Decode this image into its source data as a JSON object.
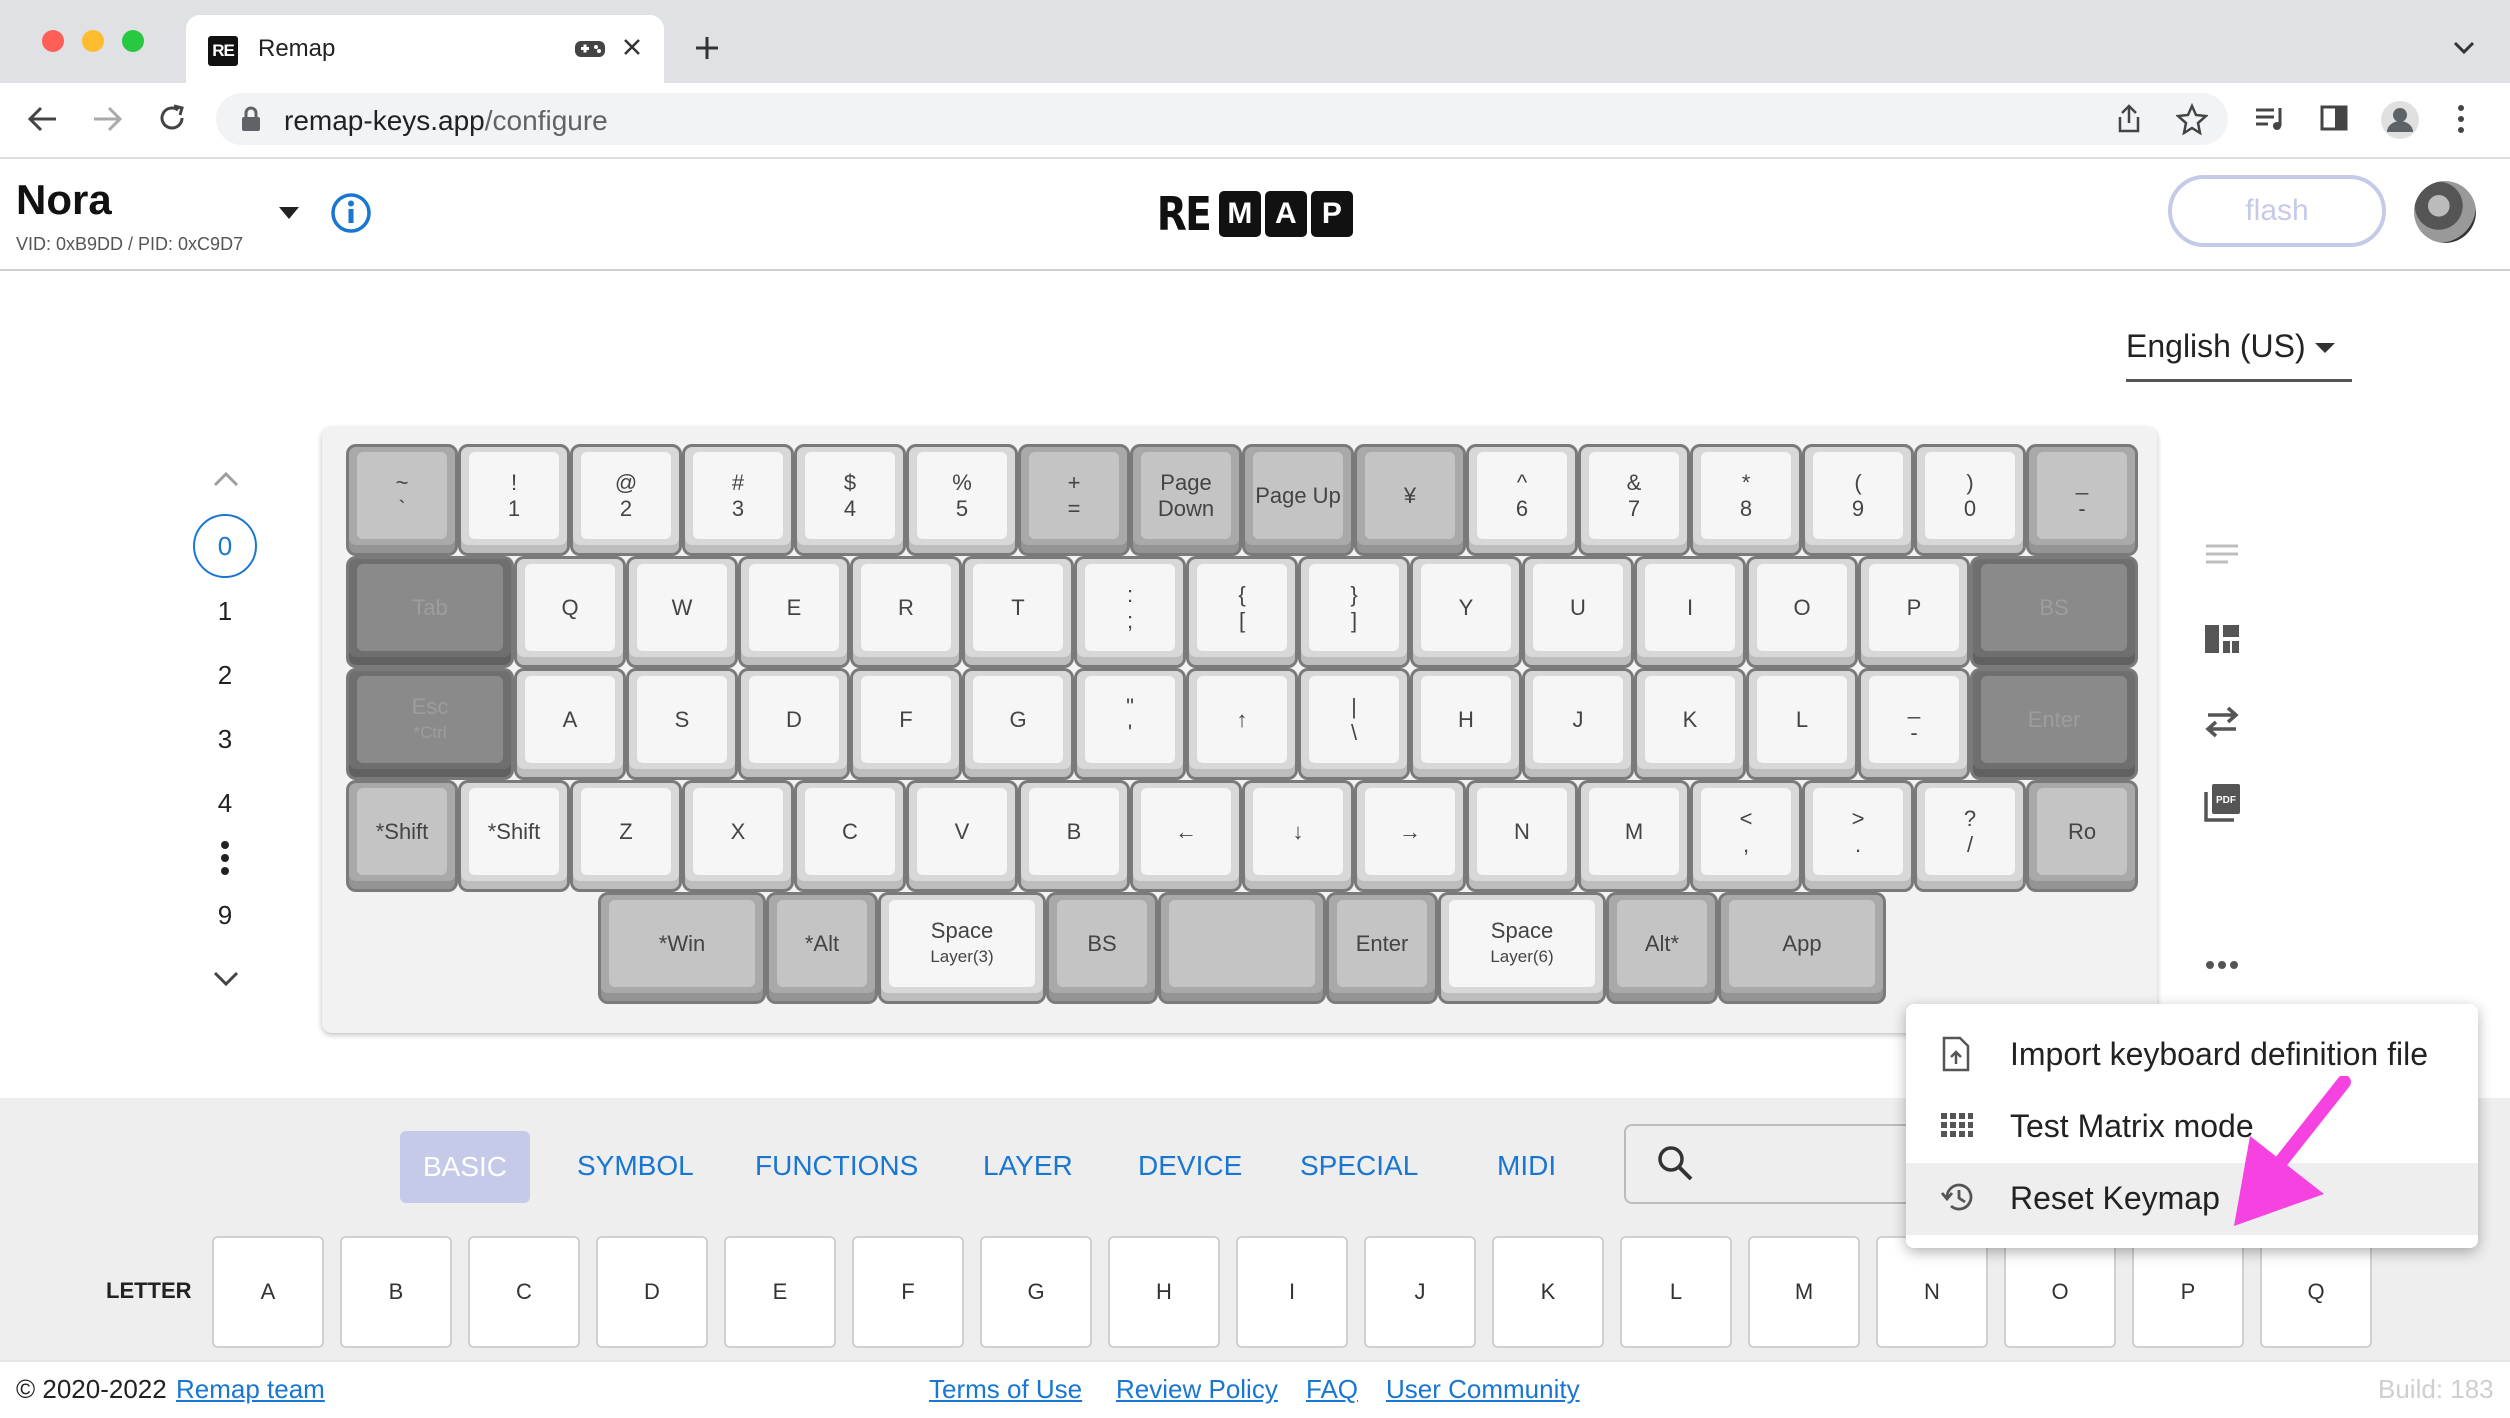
{
  "browser": {
    "tab_title": "Remap",
    "tab_favicon": "RE",
    "url_host": "remap-keys.app",
    "url_path": "/configure"
  },
  "header": {
    "keyboard_name": "Nora",
    "ids": "VID: 0xB9DD / PID: 0xC9D7",
    "logo_prefix": "RE",
    "logo_letters": [
      "M",
      "A",
      "P"
    ],
    "flash_label": "flash"
  },
  "language": "English (US)",
  "layers": {
    "items": [
      "0",
      "1",
      "2",
      "3",
      "4",
      "9"
    ]
  },
  "keyboard": {
    "rows": [
      [
        {
          "t": "~",
          "b": "`",
          "s": "md"
        },
        {
          "t": "!",
          "b": "1",
          "s": "lt"
        },
        {
          "t": "@",
          "b": "2",
          "s": "lt"
        },
        {
          "t": "#",
          "b": "3",
          "s": "lt"
        },
        {
          "t": "$",
          "b": "4",
          "s": "lt"
        },
        {
          "t": "%",
          "b": "5",
          "s": "lt"
        },
        {
          "t": "+",
          "b": "=",
          "s": "md"
        },
        {
          "t": "Page",
          "b": "Down",
          "s": "md"
        },
        {
          "t": "Page Up",
          "b": "",
          "s": "md"
        },
        {
          "t": "¥",
          "b": "",
          "s": "md"
        },
        {
          "t": "^",
          "b": "6",
          "s": "lt"
        },
        {
          "t": "&",
          "b": "7",
          "s": "lt"
        },
        {
          "t": "*",
          "b": "8",
          "s": "lt"
        },
        {
          "t": "(",
          "b": "9",
          "s": "lt"
        },
        {
          "t": ")",
          "b": "0",
          "s": "lt"
        },
        {
          "t": "_",
          "b": "-",
          "s": "md"
        }
      ],
      [
        {
          "t": "Tab",
          "b": "",
          "s": "dk"
        },
        {
          "t": "Q",
          "b": "",
          "s": "lt"
        },
        {
          "t": "W",
          "b": "",
          "s": "lt"
        },
        {
          "t": "E",
          "b": "",
          "s": "lt"
        },
        {
          "t": "R",
          "b": "",
          "s": "lt"
        },
        {
          "t": "T",
          "b": "",
          "s": "lt"
        },
        {
          "t": ":",
          "b": ";",
          "s": "lt"
        },
        {
          "t": "{",
          "b": "[",
          "s": "lt"
        },
        {
          "t": "}",
          "b": "]",
          "s": "lt"
        },
        {
          "t": "Y",
          "b": "",
          "s": "lt"
        },
        {
          "t": "U",
          "b": "",
          "s": "lt"
        },
        {
          "t": "I",
          "b": "",
          "s": "lt"
        },
        {
          "t": "O",
          "b": "",
          "s": "lt"
        },
        {
          "t": "P",
          "b": "",
          "s": "lt"
        },
        {
          "t": "BS",
          "b": "",
          "s": "dk"
        }
      ],
      [
        {
          "t": "Esc",
          "b": "*Ctrl",
          "s": "dk"
        },
        {
          "t": "A",
          "b": "",
          "s": "lt"
        },
        {
          "t": "S",
          "b": "",
          "s": "lt"
        },
        {
          "t": "D",
          "b": "",
          "s": "lt"
        },
        {
          "t": "F",
          "b": "",
          "s": "lt"
        },
        {
          "t": "G",
          "b": "",
          "s": "lt"
        },
        {
          "t": "\"",
          "b": "'",
          "s": "lt"
        },
        {
          "t": "↑",
          "b": "",
          "s": "lt"
        },
        {
          "t": "|",
          "b": "\\",
          "s": "lt"
        },
        {
          "t": "H",
          "b": "",
          "s": "lt"
        },
        {
          "t": "J",
          "b": "",
          "s": "lt"
        },
        {
          "t": "K",
          "b": "",
          "s": "lt"
        },
        {
          "t": "L",
          "b": "",
          "s": "lt"
        },
        {
          "t": "_",
          "b": "-",
          "s": "lt"
        },
        {
          "t": "Enter",
          "b": "",
          "s": "dk"
        }
      ],
      [
        {
          "t": "*Shift",
          "b": "",
          "s": "md"
        },
        {
          "t": "*Shift",
          "b": "",
          "s": "lt"
        },
        {
          "t": "Z",
          "b": "",
          "s": "lt"
        },
        {
          "t": "X",
          "b": "",
          "s": "lt"
        },
        {
          "t": "C",
          "b": "",
          "s": "lt"
        },
        {
          "t": "V",
          "b": "",
          "s": "lt"
        },
        {
          "t": "B",
          "b": "",
          "s": "lt"
        },
        {
          "t": "←",
          "b": "",
          "s": "lt"
        },
        {
          "t": "↓",
          "b": "",
          "s": "lt"
        },
        {
          "t": "→",
          "b": "",
          "s": "lt"
        },
        {
          "t": "N",
          "b": "",
          "s": "lt"
        },
        {
          "t": "M",
          "b": "",
          "s": "lt"
        },
        {
          "t": "<",
          "b": ",",
          "s": "lt"
        },
        {
          "t": ">",
          "b": ".",
          "s": "lt"
        },
        {
          "t": "?",
          "b": "/",
          "s": "lt"
        },
        {
          "t": "Ro",
          "b": "",
          "s": "md"
        }
      ],
      [
        {
          "t": "*Win",
          "b": "",
          "s": "md"
        },
        {
          "t": "*Alt",
          "b": "",
          "s": "md"
        },
        {
          "t": "Space",
          "b": "Layer(3)",
          "s": "lt"
        },
        {
          "t": "BS",
          "b": "",
          "s": "md"
        },
        {
          "t": "",
          "b": "",
          "s": "md"
        },
        {
          "t": "Enter",
          "b": "",
          "s": "md"
        },
        {
          "t": "Space",
          "b": "Layer(6)",
          "s": "lt"
        },
        {
          "t": "Alt*",
          "b": "",
          "s": "md"
        },
        {
          "t": "App",
          "b": "",
          "s": "md"
        }
      ]
    ]
  },
  "side_icons": [
    "text-lines-icon",
    "layout-icon",
    "swap-icon",
    "pdf-icon",
    "more-icon"
  ],
  "categories": {
    "active": "BASIC",
    "items": [
      "SYMBOL",
      "FUNCTIONS",
      "LAYER",
      "DEVICE",
      "SPECIAL",
      "MIDI"
    ]
  },
  "letters": {
    "label": "LETTER",
    "keys": [
      "A",
      "B",
      "C",
      "D",
      "E",
      "F",
      "G",
      "H",
      "I",
      "J",
      "K",
      "L",
      "M",
      "N",
      "O",
      "P",
      "Q"
    ]
  },
  "menu": {
    "items": [
      {
        "label": "Import keyboard definition file",
        "icon": "file-upload-icon"
      },
      {
        "label": "Test Matrix mode",
        "icon": "grid-icon"
      },
      {
        "label": "Reset Keymap",
        "icon": "history-icon"
      }
    ]
  },
  "annotation_arrow_color": "#f542e0",
  "footer": {
    "copyright": "© 2020-2022",
    "team": "Remap team",
    "links": [
      "Terms of Use",
      "Review Policy",
      "FAQ",
      "User Community"
    ],
    "build": "Build: 183"
  },
  "colors": {
    "accent": "#1976d2",
    "flash_disabled": "#c5cae9"
  }
}
